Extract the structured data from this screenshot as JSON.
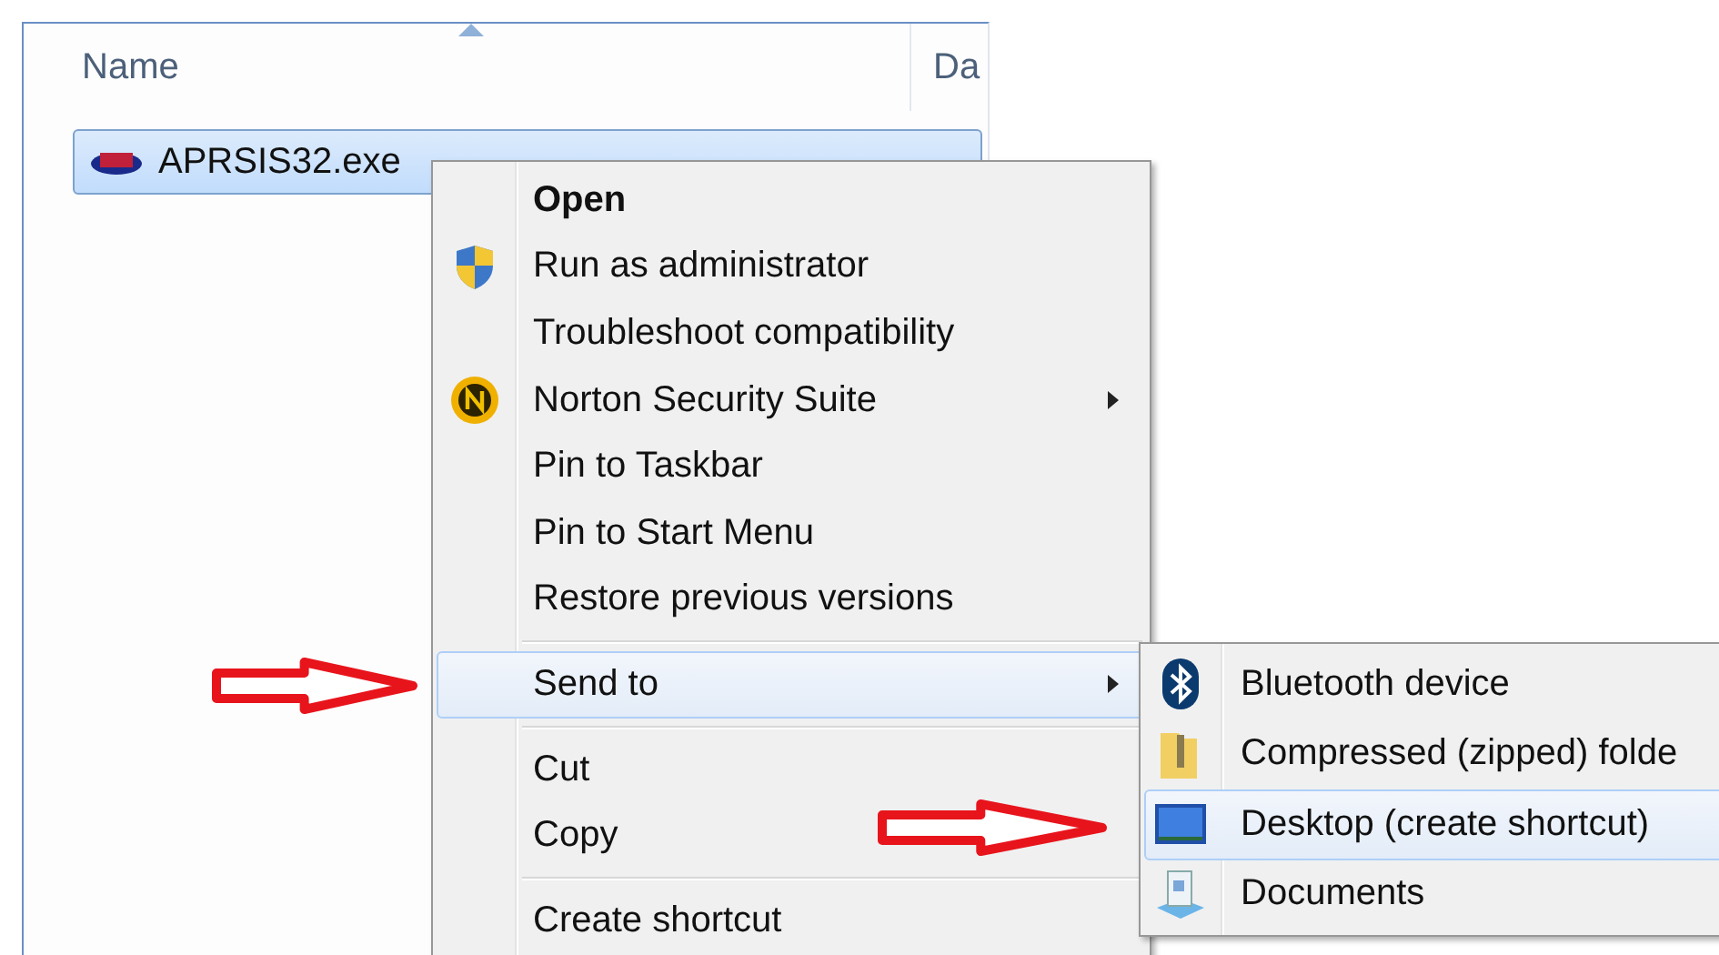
{
  "file_list": {
    "columns": [
      {
        "label": "Name",
        "sorted": true
      },
      {
        "label": "Da",
        "sorted": false
      }
    ],
    "rows": [
      {
        "name": "APRSIS32.exe",
        "selected": true
      }
    ]
  },
  "context_menu": {
    "items": [
      {
        "kind": "item",
        "label": "Open",
        "default": true,
        "submenu": false,
        "selected": false
      },
      {
        "kind": "item",
        "label": "Run as administrator",
        "default": false,
        "submenu": false,
        "selected": false
      },
      {
        "kind": "item",
        "label": "Troubleshoot compatibility",
        "default": false,
        "submenu": false,
        "selected": false
      },
      {
        "kind": "item",
        "label": "Norton Security Suite",
        "default": false,
        "submenu": true,
        "selected": false
      },
      {
        "kind": "item",
        "label": "Pin to Taskbar",
        "default": false,
        "submenu": false,
        "selected": false
      },
      {
        "kind": "item",
        "label": "Pin to Start Menu",
        "default": false,
        "submenu": false,
        "selected": false
      },
      {
        "kind": "item",
        "label": "Restore previous versions",
        "default": false,
        "submenu": false,
        "selected": false
      },
      {
        "kind": "separator"
      },
      {
        "kind": "item",
        "label": "Send to",
        "default": false,
        "submenu": true,
        "selected": true
      },
      {
        "kind": "separator"
      },
      {
        "kind": "item",
        "label": "Cut",
        "default": false,
        "submenu": false,
        "selected": false
      },
      {
        "kind": "item",
        "label": "Copy",
        "default": false,
        "submenu": false,
        "selected": false
      },
      {
        "kind": "separator"
      },
      {
        "kind": "item",
        "label": "Create shortcut",
        "default": false,
        "submenu": false,
        "selected": false
      }
    ]
  },
  "send_to_menu": {
    "items": [
      {
        "label": "Bluetooth device",
        "selected": false
      },
      {
        "label": "Compressed (zipped) folde",
        "selected": false
      },
      {
        "label": "Desktop (create shortcut)",
        "selected": true
      },
      {
        "label": "Documents",
        "selected": false
      }
    ]
  }
}
